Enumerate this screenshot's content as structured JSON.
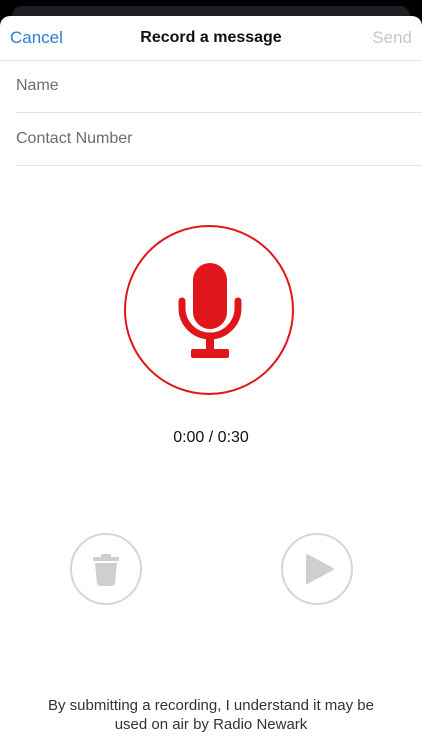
{
  "navbar": {
    "cancel_label": "Cancel",
    "title": "Record a message",
    "send_label": "Send"
  },
  "form": {
    "name_placeholder": "Name",
    "name_value": "",
    "contact_placeholder": "Contact Number",
    "contact_value": ""
  },
  "recorder": {
    "icon": "microphone-icon",
    "timer": "0:00 / 0:30"
  },
  "controls": {
    "delete_icon": "trash-icon",
    "play_icon": "play-icon"
  },
  "disclaimer": {
    "line1": "By submitting a recording, I understand it may be",
    "line2": "used on air by Radio Newark"
  },
  "colors": {
    "accent_blue": "#2e7bd6",
    "record_red": "#e1161b",
    "disabled_gray": "#c6c6c8",
    "control_gray": "#d6d6d6"
  }
}
